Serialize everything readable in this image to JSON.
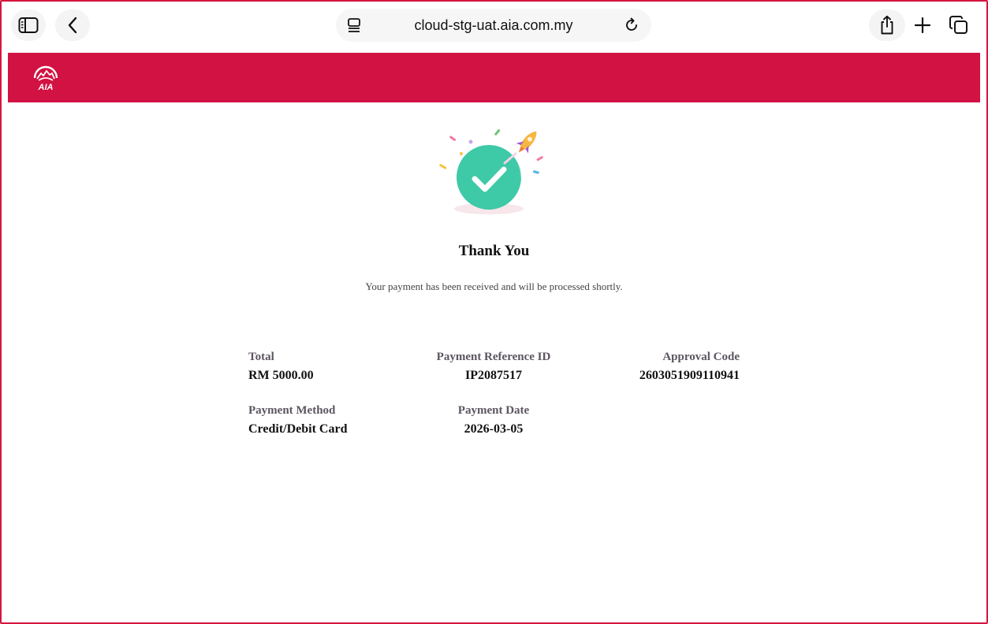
{
  "browser": {
    "url": "cloud-stg-uat.aia.com.my",
    "icons": {
      "sidebar": "sidebar-icon",
      "back": "chevron-left-icon",
      "reader": "reader-icon",
      "reload": "reload-icon",
      "share": "share-icon",
      "new_tab": "plus-icon",
      "tabs": "tabs-icon"
    }
  },
  "header": {
    "brand": "AIA",
    "color": "#d21242"
  },
  "confirmation": {
    "title": "Thank You",
    "message": "Your payment has been received and will be processed shortly.",
    "check_color": "#3ec9a7"
  },
  "details": {
    "total": {
      "label": "Total",
      "value": "RM 5000.00"
    },
    "reference": {
      "label": "Payment Reference ID",
      "value": "IP2087517"
    },
    "approval": {
      "label": "Approval Code",
      "value": "2603051909110941"
    },
    "method": {
      "label": "Payment Method",
      "value": "Credit/Debit Card"
    },
    "date": {
      "label": "Payment Date",
      "value": "2026-03-05"
    }
  }
}
